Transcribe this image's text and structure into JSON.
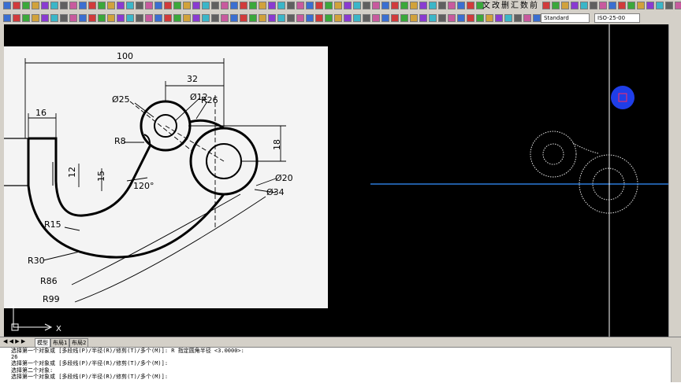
{
  "toolbar": {
    "text_style": "Standard",
    "dim_style": "ISO-25-00",
    "text_icons": [
      "文",
      "改",
      "删",
      "汇",
      "数",
      "前"
    ]
  },
  "colors": {
    "canvas_bg": "#000000",
    "drawing_bg": "#f4f4f4",
    "crosshair": "#ffffff",
    "dynamic_line": "#2a7ad9",
    "cursor_marker": "#1f3ee8",
    "cursor_square": "#ff2a60"
  },
  "drawing": {
    "dims": {
      "d100": "100",
      "d32": "32",
      "d16": "16",
      "phi25": "Ø25",
      "phi12": "Ø12",
      "r26": "R26",
      "r8": "R8",
      "d18": "18",
      "d12": "12",
      "d15": "15",
      "a120": "120°",
      "phi20": "Ø20",
      "phi34": "Ø34",
      "r15": "R15",
      "r30": "R30",
      "r86": "R86",
      "r99": "R99"
    }
  },
  "ucs": {
    "x_label": "X"
  },
  "tabs": [
    {
      "label": "模型"
    },
    {
      "label": "布局1"
    },
    {
      "label": "布局2"
    }
  ],
  "command_lines": [
    "选择第一个对象或 [多段线(P)/半径(R)/修剪(T)/多个(M)]: R 指定圆角半径 <3.0000>:",
    "26",
    "选择第一个对象或 [多段线(P)/半径(R)/修剪(T)/多个(M)]:",
    "选择第二个对象:",
    "选择第一个对象或 [多段线(P)/半径(R)/修剪(T)/多个(M)]:"
  ]
}
